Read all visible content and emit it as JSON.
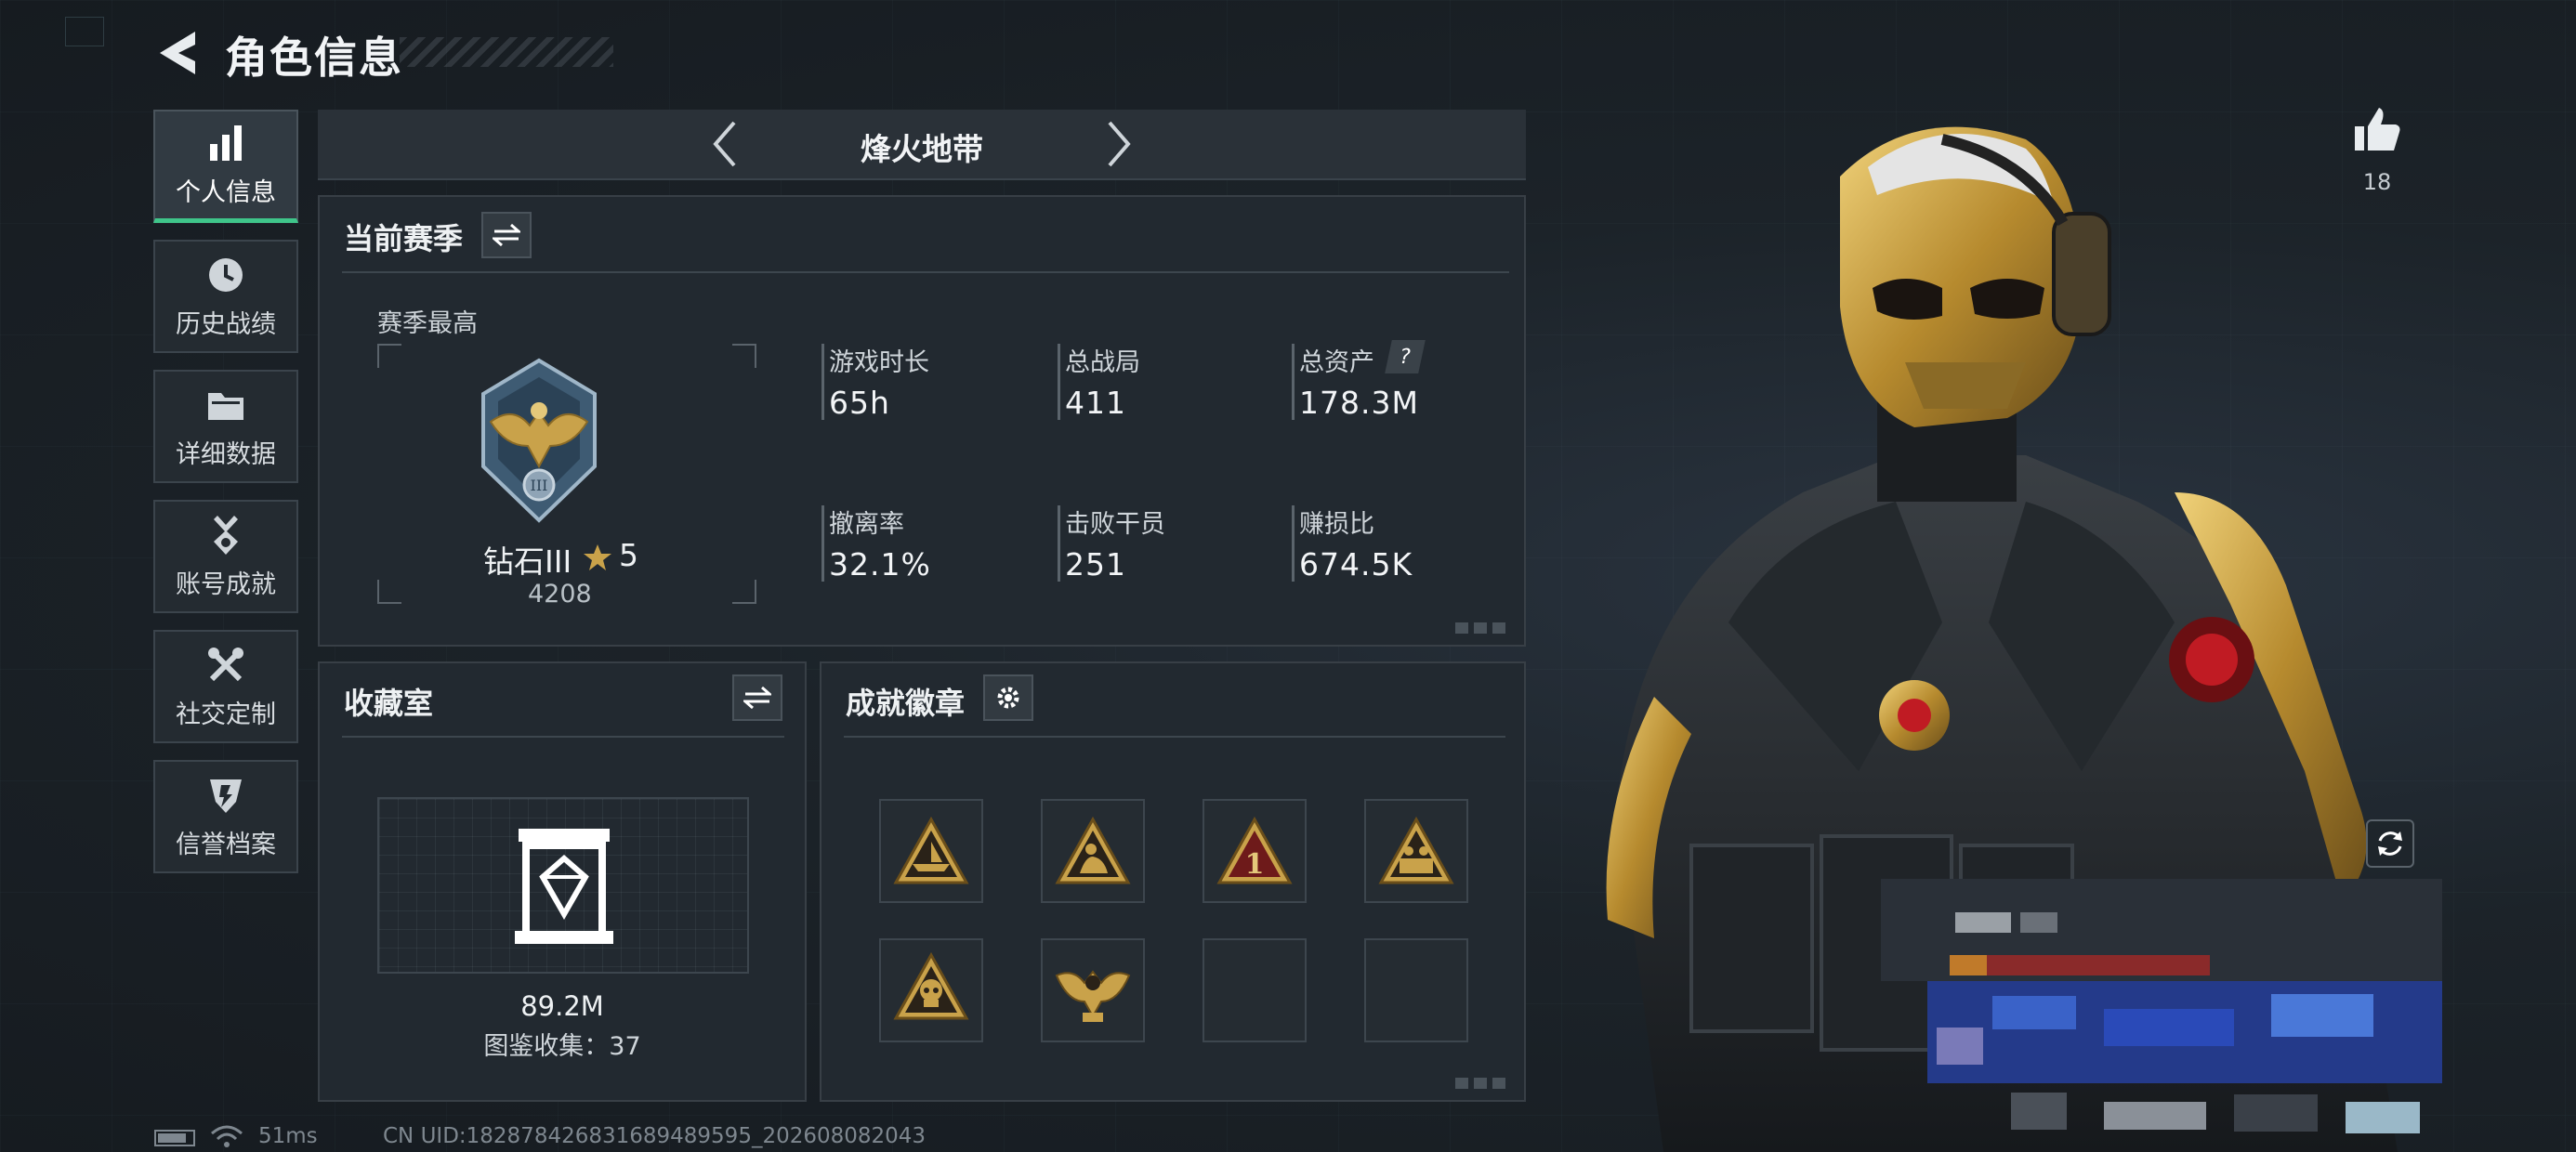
{
  "header": {
    "title": "角色信息"
  },
  "sidebar": {
    "items": [
      {
        "label": "个人信息",
        "active": true,
        "icon": "bar-chart-icon"
      },
      {
        "label": "历史战绩",
        "icon": "clock-icon"
      },
      {
        "label": "详细数据",
        "icon": "folder-icon"
      },
      {
        "label": "账号成就",
        "icon": "medal-icon"
      },
      {
        "label": "社交定制",
        "icon": "tools-icon"
      },
      {
        "label": "信誉档案",
        "icon": "shield-icon"
      }
    ]
  },
  "mode": {
    "label": "烽火地带"
  },
  "season": {
    "title": "当前赛季",
    "best_label": "赛季最高",
    "rank_name": "钻石III",
    "stars": "5",
    "score": "4208",
    "stats": [
      {
        "label": "游戏时长",
        "value": "65h"
      },
      {
        "label": "总战局",
        "value": "411"
      },
      {
        "label": "总资产",
        "value": "178.3M",
        "help": "?"
      },
      {
        "label": "撤离率",
        "value": "32.1%"
      },
      {
        "label": "击败干员",
        "value": "251"
      },
      {
        "label": "赚损比",
        "value": "674.5K"
      }
    ]
  },
  "collection": {
    "title": "收藏室",
    "value": "89.2M",
    "count_text": "图鉴收集：37"
  },
  "achievements": {
    "title": "成就徽章",
    "badges": [
      "badge-boat",
      "badge-soldier",
      "badge-number-one",
      "badge-squad",
      "badge-skull",
      "badge-eagle",
      "",
      ""
    ],
    "badge_one_text": "1"
  },
  "likes": {
    "count": "18"
  },
  "status_bar": {
    "ping": "51ms",
    "uid": "CN UID:1828784268316894895​95_202608082043"
  },
  "colors": {
    "accent_green": "#3fc58a",
    "panel": "#222930",
    "gold": "#c9a24a"
  }
}
